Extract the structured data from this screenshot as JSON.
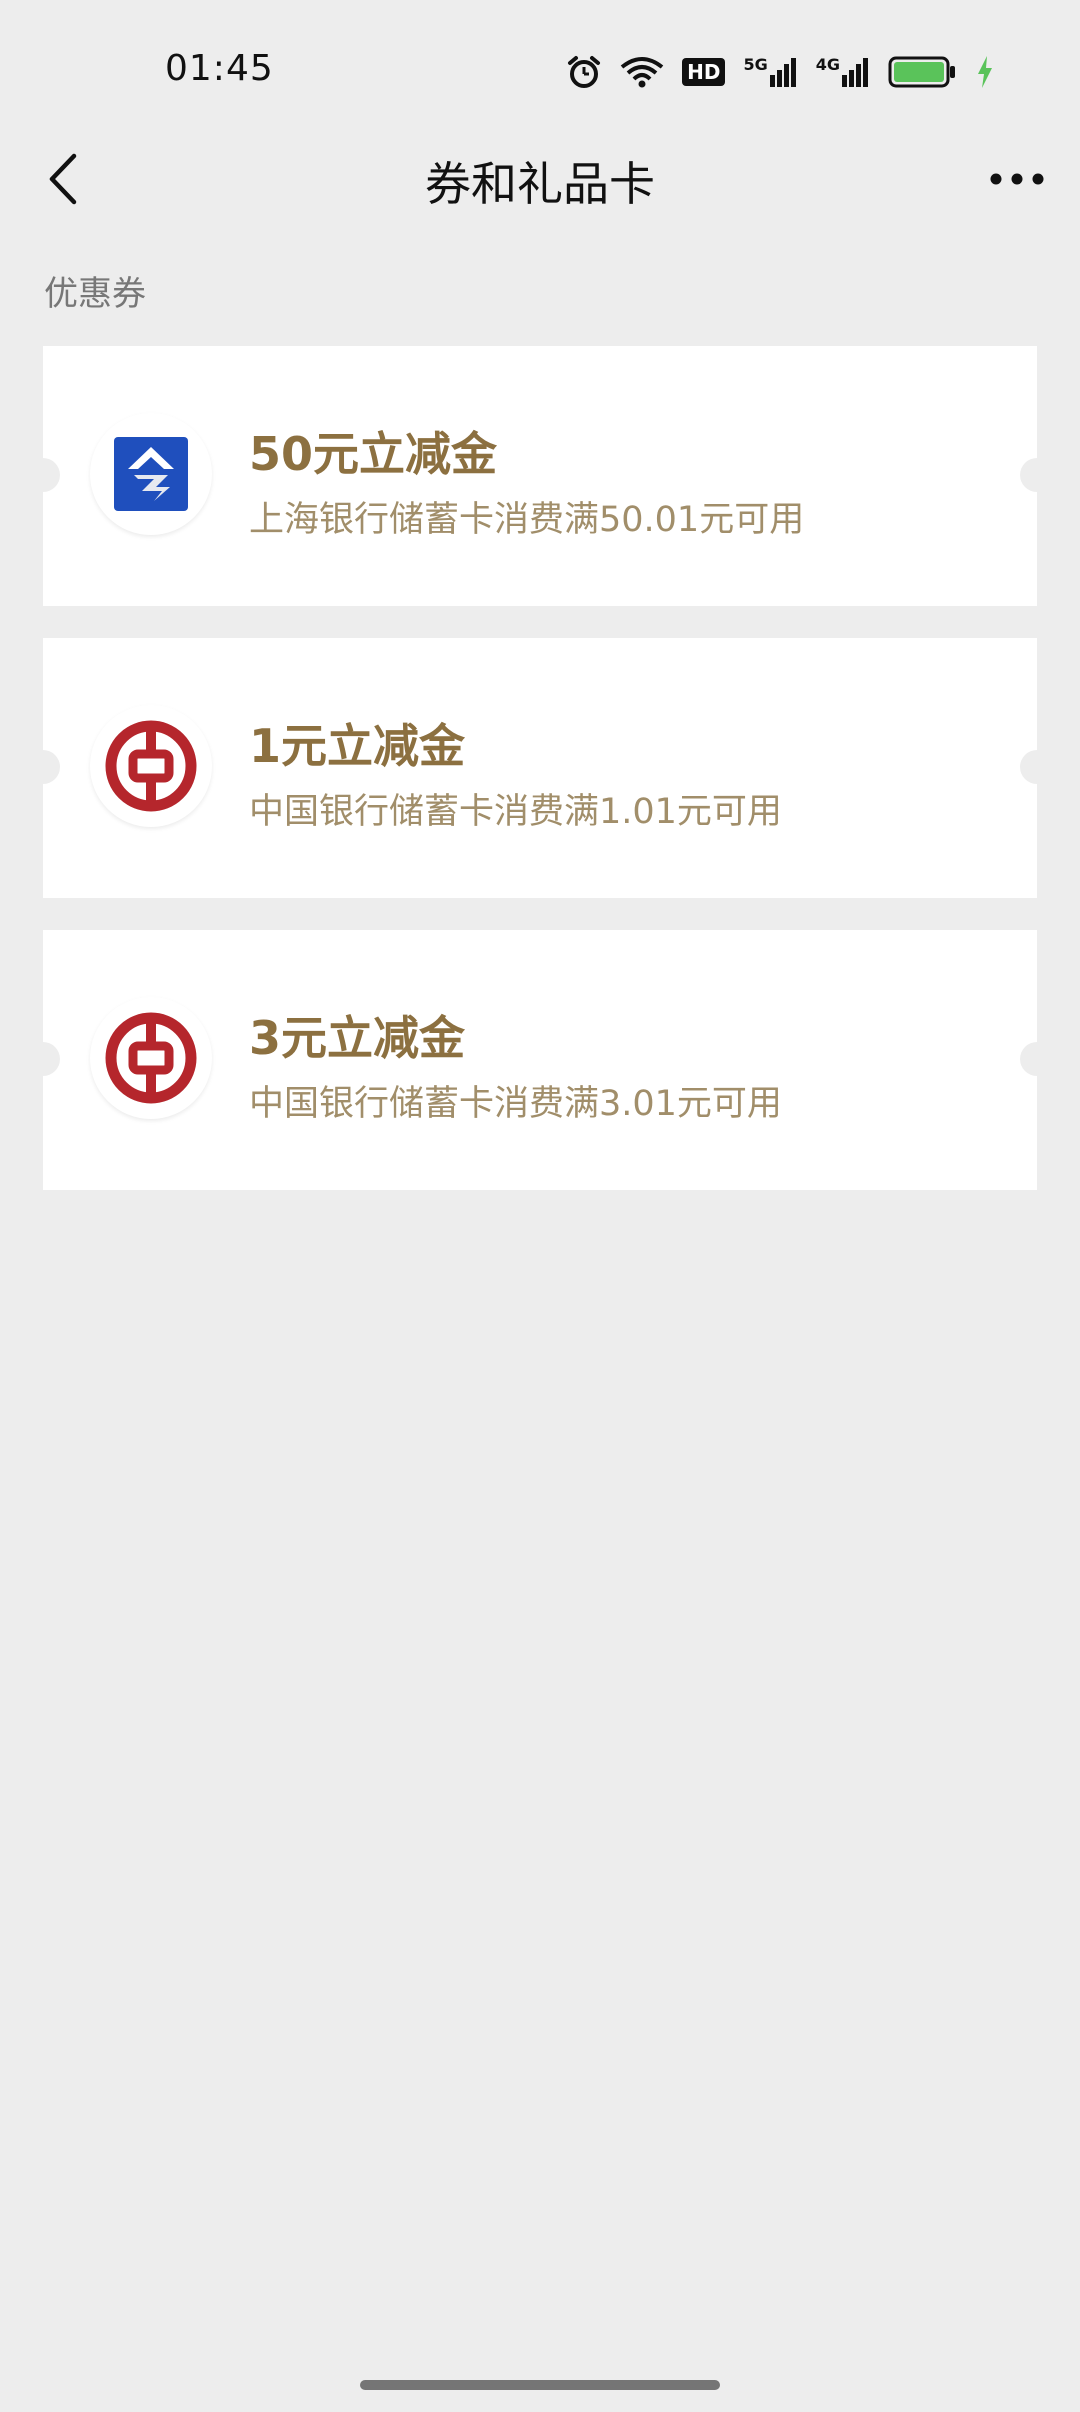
{
  "status_bar": {
    "time": "01:45",
    "network_5g": "5G",
    "network_4g": "4G",
    "hd_label": "HD"
  },
  "header": {
    "title": "券和礼品卡"
  },
  "section": {
    "title": "优惠券"
  },
  "coupons": [
    {
      "title": "50元立减金",
      "desc": "上海银行储蓄卡消费满50.01元可用",
      "bank": "bank-of-shanghai"
    },
    {
      "title": "1元立减金",
      "desc": "中国银行储蓄卡消费满1.01元可用",
      "bank": "bank-of-china"
    },
    {
      "title": "3元立减金",
      "desc": "中国银行储蓄卡消费满3.01元可用",
      "bank": "bank-of-china"
    }
  ],
  "colors": {
    "background": "#ededed",
    "card": "#ffffff",
    "coupon_title": "#8c7040",
    "coupon_desc": "#a18e6a",
    "boc_red": "#b5262c",
    "bos_blue": "#1f4fbd",
    "battery_green": "#5ac35a"
  }
}
